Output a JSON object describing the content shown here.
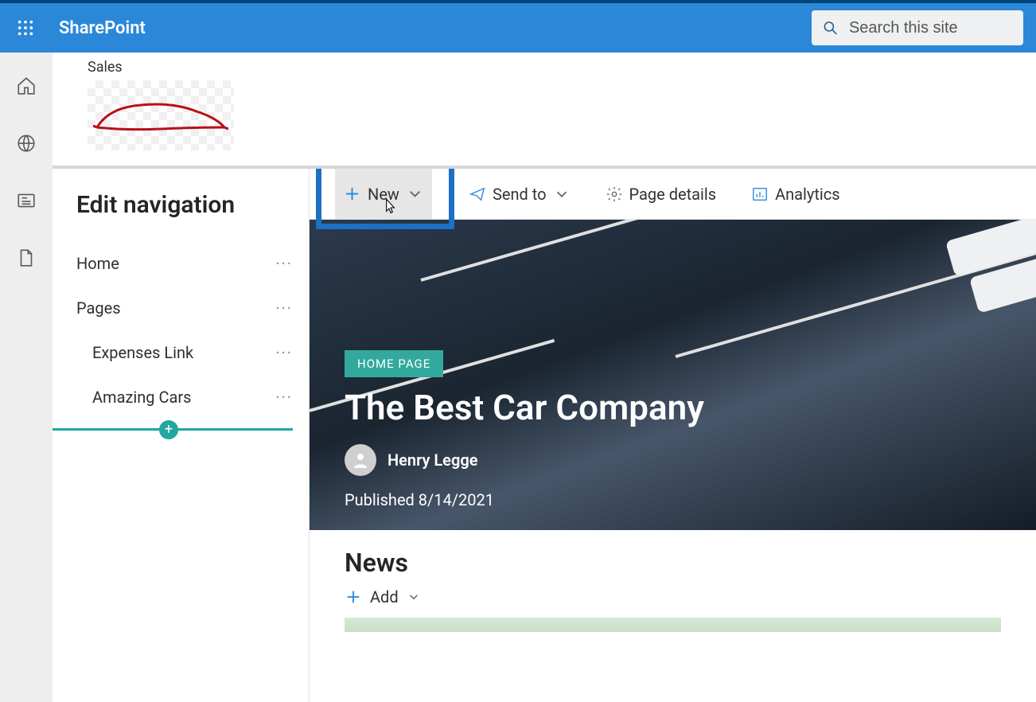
{
  "header": {
    "app_name": "SharePoint",
    "search_placeholder": "Search this site"
  },
  "site": {
    "name": "Sales"
  },
  "nav": {
    "title": "Edit navigation",
    "items": [
      {
        "label": "Home",
        "indent": false
      },
      {
        "label": "Pages",
        "indent": false
      },
      {
        "label": "Expenses Link",
        "indent": true
      },
      {
        "label": "Amazing Cars",
        "indent": true
      }
    ]
  },
  "toolbar": {
    "new_label": "New",
    "send_label": "Send to",
    "pagedetails_label": "Page details",
    "analytics_label": "Analytics"
  },
  "hero": {
    "badge": "HOME PAGE",
    "title": "The Best Car Company",
    "author": "Henry Legge",
    "published": "Published 8/14/2021"
  },
  "news": {
    "title": "News",
    "add_label": "Add"
  }
}
